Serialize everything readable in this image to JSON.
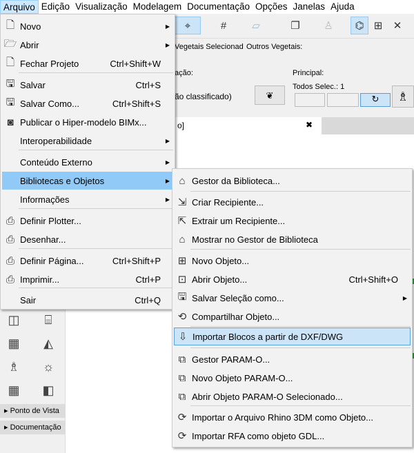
{
  "menubar": [
    "Arquivo",
    "Edição",
    "Visualização",
    "Modelagem",
    "Documentação",
    "Opções",
    "Janelas",
    "Ajuda"
  ],
  "toolbar": {
    "vegetais_sel": "Vegetais Selecionad",
    "outros_vegetais": "Outros Vegetais:",
    "classificacao": "ação:",
    "nao_classificado": "ão classificado)",
    "principal": "Principal:",
    "todos_selec": "Todos Selec.: 1",
    "tab_text": "o]",
    "close": "✖"
  },
  "toolbox": {
    "sections": [
      "Ponto de Vista",
      "Documentação"
    ]
  },
  "file_menu": [
    {
      "label": "Novo",
      "icon": "new-doc-icon",
      "arrow": true
    },
    {
      "label": "Abrir",
      "icon": "open-folder-icon",
      "arrow": true
    },
    {
      "label": "Fechar Projeto",
      "shortcut": "Ctrl+Shift+W",
      "icon": "close-doc-icon"
    },
    {
      "label": "Salvar",
      "shortcut": "Ctrl+S",
      "icon": "save-icon"
    },
    {
      "label": "Salvar Como...",
      "shortcut": "Ctrl+Shift+S",
      "icon": "save-as-icon"
    },
    {
      "label": "Publicar o Hiper-modelo BIMx...",
      "icon": "bimx-icon"
    },
    {
      "label": "Interoperabilidade",
      "arrow": true
    },
    {
      "label": "Conteúdo Externo",
      "arrow": true
    },
    {
      "label": "Bibliotecas e Objetos",
      "arrow": true
    },
    {
      "label": "Informações",
      "arrow": true
    },
    {
      "label": "Definir Plotter...",
      "icon": "plotter-icon"
    },
    {
      "label": "Desenhar...",
      "icon": "plot-icon"
    },
    {
      "label": "Definir Página...",
      "shortcut": "Ctrl+Shift+P",
      "icon": "page-setup-icon"
    },
    {
      "label": "Imprimir...",
      "shortcut": "Ctrl+P",
      "icon": "print-icon"
    },
    {
      "label": "Sair",
      "shortcut": "Ctrl+Q"
    }
  ],
  "lib_menu": [
    {
      "label": "Gestor da Biblioteca...",
      "icon": "library-icon"
    },
    {
      "label": "Criar Recipiente...",
      "icon": "create-container-icon"
    },
    {
      "label": "Extrair um Recipiente...",
      "icon": "extract-container-icon"
    },
    {
      "label": "Mostrar no Gestor de Biblioteca",
      "icon": "show-library-icon"
    },
    {
      "label": "Novo Objeto...",
      "icon": "new-object-icon"
    },
    {
      "label": "Abrir Objeto...",
      "shortcut": "Ctrl+Shift+O",
      "icon": "open-object-icon"
    },
    {
      "label": "Salvar Seleção como...",
      "icon": "save-selection-icon",
      "arrow": true
    },
    {
      "label": "Compartilhar Objeto...",
      "icon": "share-icon"
    },
    {
      "label": "Importar Blocos a partir de DXF/DWG",
      "icon": "import-dwg-icon"
    },
    {
      "label": "Gestor PARAM-O...",
      "icon": "param-o-icon"
    },
    {
      "label": "Novo Objeto PARAM-O...",
      "icon": "new-param-o-icon"
    },
    {
      "label": "Abrir Objeto PARAM-O Selecionado...",
      "icon": "open-param-o-icon"
    },
    {
      "label": "Importar o Arquivo Rhino 3DM como Objeto...",
      "icon": "rhino-icon"
    },
    {
      "label": "Importar RFA como objeto GDL...",
      "icon": "rfa-icon"
    }
  ]
}
